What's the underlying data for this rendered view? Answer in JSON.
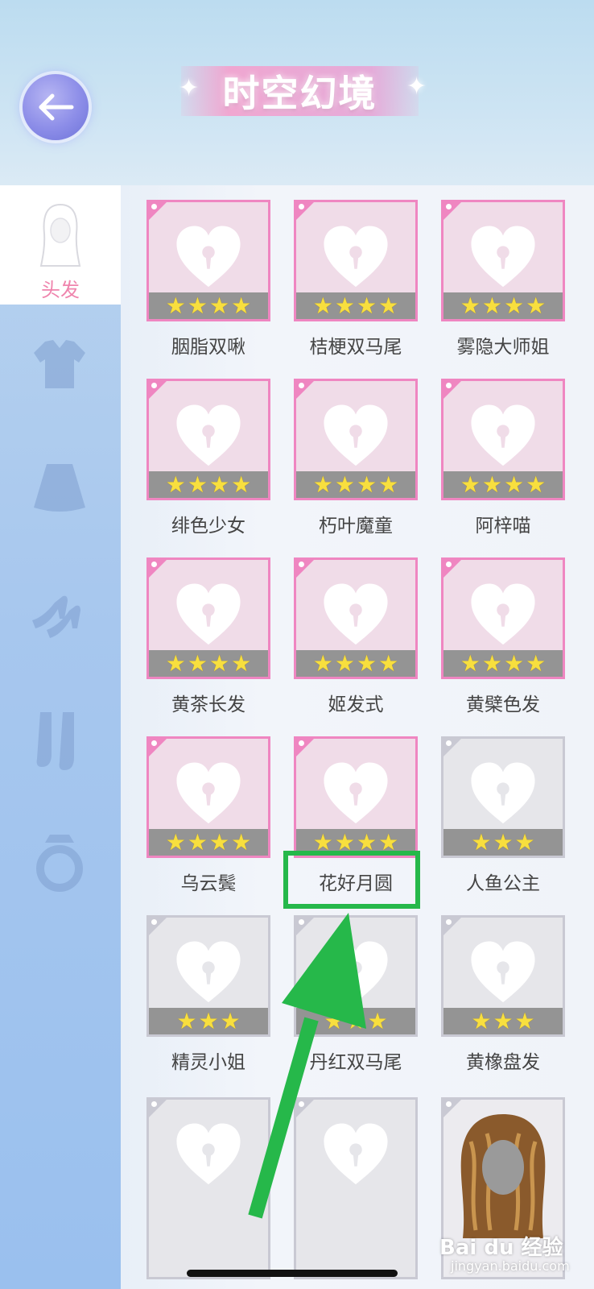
{
  "header": {
    "title": "时空幻境",
    "back_icon": "back-arrow-icon"
  },
  "sidebar": {
    "active_label": "头发",
    "categories": [
      "hair-icon",
      "top-icon",
      "skirt-icon",
      "shoes-icon",
      "socks-icon",
      "ring-icon"
    ]
  },
  "items": [
    {
      "name": "胭脂双啾",
      "stars": 4,
      "unlocked": true
    },
    {
      "name": "桔梗双马尾",
      "stars": 4,
      "unlocked": true
    },
    {
      "name": "雾隐大师姐",
      "stars": 4,
      "unlocked": true
    },
    {
      "name": "绯色少女",
      "stars": 4,
      "unlocked": true
    },
    {
      "name": "朽叶魔童",
      "stars": 4,
      "unlocked": true
    },
    {
      "name": "阿梓喵",
      "stars": 4,
      "unlocked": true
    },
    {
      "name": "黄茶长发",
      "stars": 4,
      "unlocked": true
    },
    {
      "name": "姬发式",
      "stars": 4,
      "unlocked": true
    },
    {
      "name": "黄檗色发",
      "stars": 4,
      "unlocked": true
    },
    {
      "name": "乌云鬓",
      "stars": 4,
      "unlocked": true
    },
    {
      "name": "花好月圆",
      "stars": 4,
      "unlocked": true
    },
    {
      "name": "人鱼公主",
      "stars": 3,
      "unlocked": false
    },
    {
      "name": "精灵小姐",
      "stars": 3,
      "unlocked": false
    },
    {
      "name": "丹红双马尾",
      "stars": 3,
      "unlocked": false
    },
    {
      "name": "黄橡盘发",
      "stars": 3,
      "unlocked": false
    }
  ],
  "colors": {
    "pink_border": "#ef86c1",
    "grey_border": "#c9c9d3",
    "highlight": "#26b84a",
    "active_label": "#ef84ad"
  },
  "watermark": {
    "brand": "Bai du 经验",
    "url": "jingyan.baidu.com"
  }
}
